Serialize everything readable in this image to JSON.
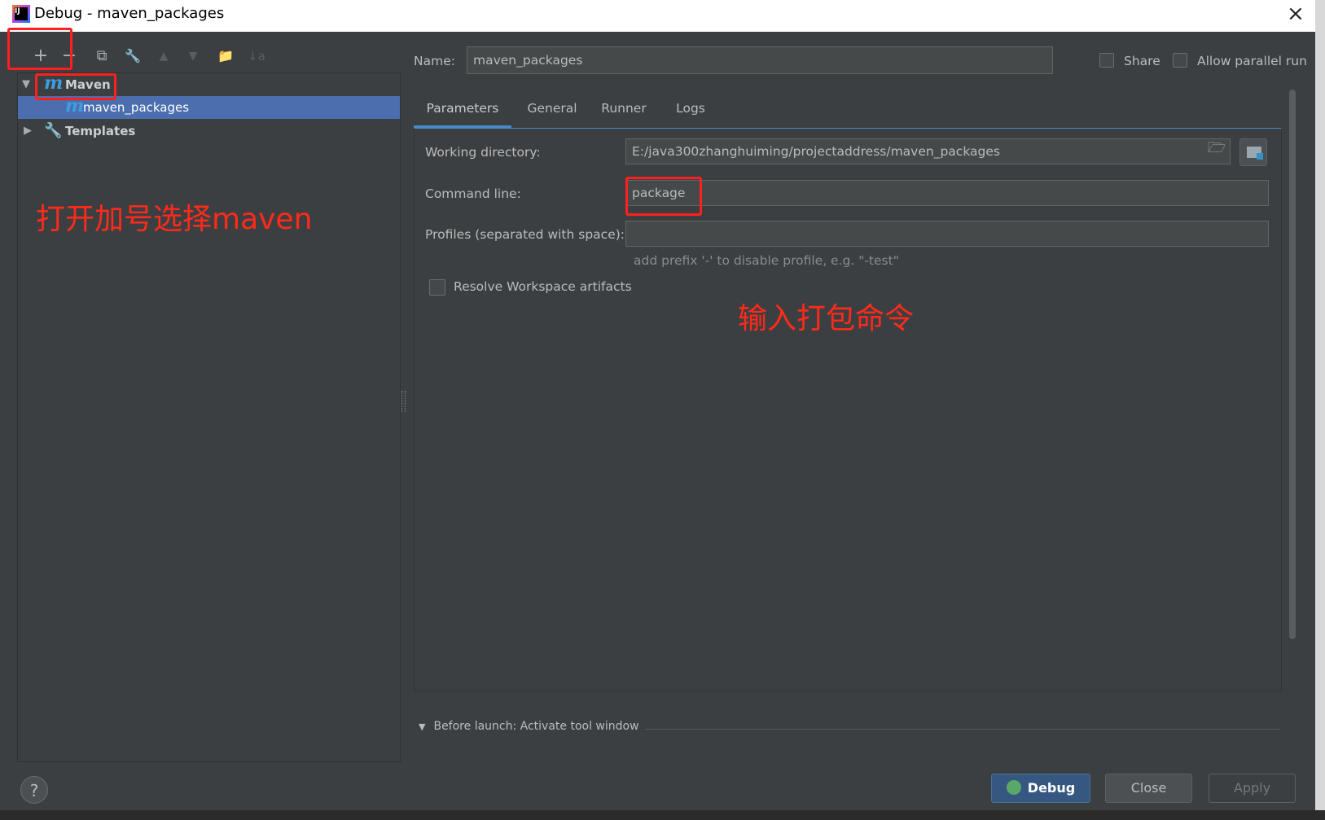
{
  "window": {
    "title": "Debug - maven_packages",
    "close_icon": "×"
  },
  "toolbar": {
    "add": "+",
    "remove": "−",
    "copy": "⧉",
    "edit_defaults": "🔧",
    "move_up": "▲",
    "move_down": "▼",
    "new_folder": "📁",
    "sort": "↓a"
  },
  "tree": {
    "maven_label": "Maven",
    "maven_child": "maven_packages",
    "templates_label": "Templates",
    "m_glyph": "m"
  },
  "config": {
    "name_label": "Name:",
    "name_value": "maven_packages",
    "share_label": "Share",
    "parallel_label": "Allow parallel run"
  },
  "tabs": [
    "Parameters",
    "General",
    "Runner",
    "Logs"
  ],
  "parameters": {
    "working_dir_label": "Working directory:",
    "working_dir_value": "E:/java300zhanghuiming/projectaddress/maven_packages",
    "command_label": "Command line:",
    "command_value": "package",
    "profiles_label": "Profiles (separated with space):",
    "profiles_value": "",
    "profiles_hint": "add prefix '-' to disable profile, e.g. \"-test\"",
    "resolve_label": "Resolve Workspace artifacts"
  },
  "before_launch": "Before launch: Activate tool window",
  "buttons": {
    "help": "?",
    "debug": "Debug",
    "close": "Close",
    "apply": "Apply"
  },
  "annotations": {
    "left": "打开加号选择maven",
    "right": "输入打包命令"
  }
}
